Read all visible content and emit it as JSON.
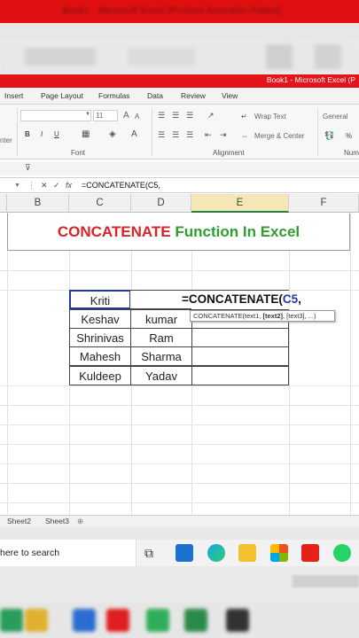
{
  "window": {
    "title": "Book1 - Microsoft Excel (Product Activation Failed)",
    "title_short": "Book1 - Microsoft Excel (P"
  },
  "blurred_top": {
    "title": "Book1 - Microsoft Excel (Product Activation Failed)"
  },
  "ribbon_tabs": [
    "Insert",
    "Page Layout",
    "Formulas",
    "Data",
    "Review",
    "View"
  ],
  "ribbon": {
    "font_size": "11",
    "font_inc": "A",
    "font_dec": "A",
    "bold": "B",
    "italic": "I",
    "underline": "U",
    "font_color": "A",
    "wrap_text": "Wrap Text",
    "merge_center": "Merge & Center",
    "number_format": "General",
    "percent": "%",
    "group_font": "Font",
    "group_alignment": "Alignment",
    "group_number": "Num",
    "left_group_fragment": "nter"
  },
  "formula_bar": {
    "cancel": "✕",
    "enter": "✓",
    "fx": "fx",
    "content": "=CONCATENATE(C5,"
  },
  "columns": [
    {
      "name": "B",
      "selected": false
    },
    {
      "name": "C",
      "selected": false
    },
    {
      "name": "D",
      "selected": false
    },
    {
      "name": "E",
      "selected": true
    },
    {
      "name": "F",
      "selected": false
    }
  ],
  "banner": {
    "word1": "CONCATENATE",
    "word2": "Function In Excel",
    "color1": "#d9222a",
    "color2": "#2e9e2e"
  },
  "table": {
    "rows": [
      {
        "first": "Kriti",
        "last": ""
      },
      {
        "first": "Keshav",
        "last": "kumar"
      },
      {
        "first": "Shrinivas",
        "last": "Ram"
      },
      {
        "first": "Mahesh",
        "last": "Sharma"
      },
      {
        "first": "Kuldeep",
        "last": "Yadav"
      }
    ]
  },
  "editing": {
    "prefix": "=CONCATENATE(",
    "ref": "C5",
    "suffix": ",",
    "ref_color": "#1f3a9e"
  },
  "tooltip": {
    "pre": "CONCATENATE(text1, ",
    "bold": "[text2]",
    "post": ", [text3], ...)"
  },
  "sheet_tabs": [
    "Sheet2",
    "Sheet3"
  ],
  "taskbar": {
    "search_text": "here to search"
  }
}
